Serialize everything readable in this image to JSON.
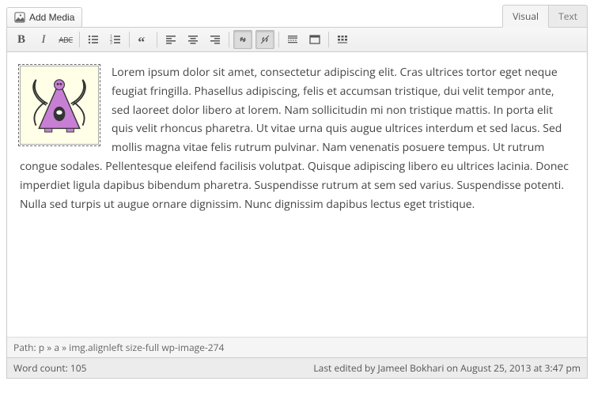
{
  "top": {
    "add_media": "Add Media",
    "tab_visual": "Visual",
    "tab_text": "Text"
  },
  "content": {
    "paragraph": "Lorem ipsum dolor sit amet, consectetur adipiscing elit. Cras ultrices tortor eget neque feugiat fringilla. Phasellus adipiscing, felis et accumsan tristique, dui velit tempor ante, sed laoreet dolor libero at lorem. Nam sollicitudin mi non tristique mattis. In porta elit quis velit rhoncus pharetra. Ut vitae urna quis augue ultrices interdum et sed lacus. Sed mollis magna vitae felis rutrum pulvinar. Nam venenatis posuere tempus. Ut rutrum congue sodales. Pellentesque eleifend facilisis volutpat. Quisque adipiscing libero eu ultrices lacinia. Donec imperdiet ligula dapibus bibendum pharetra. Suspendisse rutrum at sem sed varius. Suspendisse potenti. Nulla sed turpis ut augue ornare dignissim. Nunc dignissim dapibus lectus eget tristique."
  },
  "footer": {
    "path": "Path: p » a » img.alignleft size-full wp-image-274",
    "word_count_label": "Word count: 105",
    "last_edited": "Last edited by Jameel Bokhari on August 25, 2013 at 3:47 pm"
  }
}
